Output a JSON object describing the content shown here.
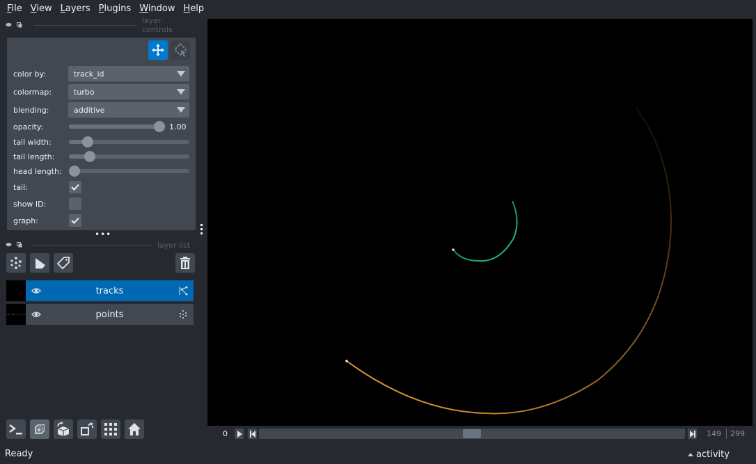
{
  "menu": [
    {
      "label": "File",
      "mnemonic": "F",
      "rest": "ile"
    },
    {
      "label": "View",
      "mnemonic": "V",
      "rest": "iew"
    },
    {
      "label": "Layers",
      "mnemonic": "L",
      "rest": "ayers"
    },
    {
      "label": "Plugins",
      "mnemonic": "P",
      "rest": "lugins"
    },
    {
      "label": "Window",
      "mnemonic": "W",
      "rest": "indow"
    },
    {
      "label": "Help",
      "mnemonic": "H",
      "rest": "elp"
    }
  ],
  "layer_controls": {
    "title": "layer controls",
    "modes": [
      {
        "name": "pan-zoom",
        "icon": "move-arrows-icon",
        "active": true
      },
      {
        "name": "transform",
        "icon": "select-transform-icon",
        "active": false
      }
    ],
    "color_by": {
      "label": "color by:",
      "value": "track_id"
    },
    "colormap": {
      "label": "colormap:",
      "value": "turbo"
    },
    "blending": {
      "label": "blending:",
      "value": "additive"
    },
    "opacity": {
      "label": "opacity:",
      "value": 1.0,
      "display": "1.00"
    },
    "tail_width": {
      "label": "tail width:",
      "fraction": 0.12
    },
    "tail_length": {
      "label": "tail length:",
      "fraction": 0.14
    },
    "head_length": {
      "label": "head length:",
      "fraction": 0.0
    },
    "tail": {
      "label": "tail:",
      "checked": true
    },
    "show_id": {
      "label": "show ID:",
      "checked": false
    },
    "graph": {
      "label": "graph:",
      "checked": true
    }
  },
  "layer_list": {
    "title": "layer list",
    "buttons": [
      "new-points-layer",
      "new-shapes-layer",
      "new-labels-layer",
      "delete-layer"
    ],
    "layers": [
      {
        "name": "tracks",
        "visible": true,
        "selected": true,
        "type_icon": "tracks-icon"
      },
      {
        "name": "points",
        "visible": true,
        "selected": false,
        "type_icon": "points-icon"
      }
    ]
  },
  "viewer_buttons": [
    "console",
    "ndisplay-3d",
    "roll-dims",
    "transpose",
    "grid",
    "home"
  ],
  "dims": {
    "frame_label": "0",
    "current": "149",
    "total": "299",
    "position_fraction": 0.5
  },
  "status": {
    "text": "Ready",
    "activity_label": "activity"
  },
  "colors": {
    "accent": "#007acc",
    "panel": "#414851",
    "background": "#262930",
    "inner_track": "#1fc9a0",
    "outer_track": "#e8a030"
  }
}
